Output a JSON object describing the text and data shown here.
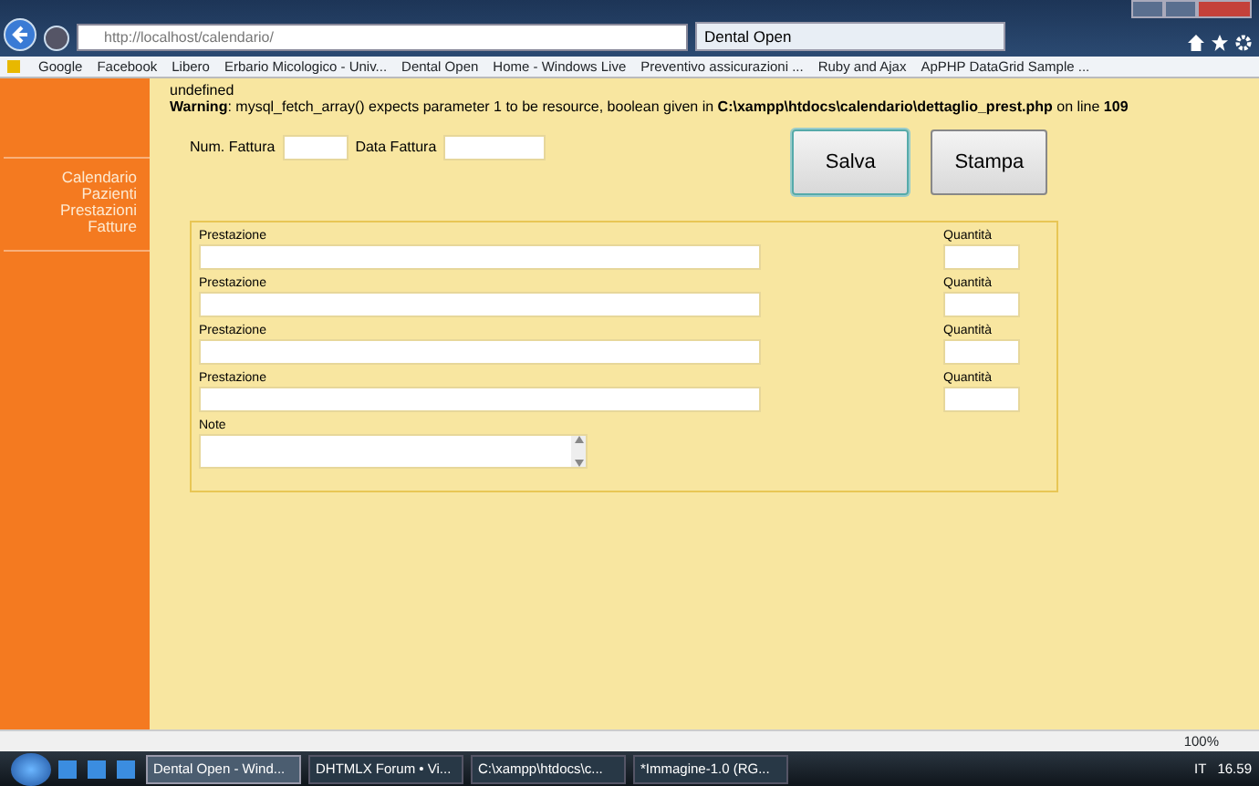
{
  "browser": {
    "address": "http://localhost/calendario/",
    "tabs": [
      {
        "label": "Dental Open",
        "selected": true
      }
    ],
    "favorites": [
      "Google",
      "Facebook",
      "Libero",
      "Erbario Micologico - Univ...",
      "Dental Open",
      "Home - Windows Live",
      "Preventivo assicurazioni ...",
      "Ruby and Ajax",
      "ApPHP DataGrid  Sample ..."
    ]
  },
  "sidebar": {
    "items": [
      "Calendario",
      "Pazienti",
      "Prestazioni",
      "Fatture"
    ]
  },
  "messages": [
    "undefined",
    "**Warning**: mysql_fetch_array() expects parameter 1 to be resource, boolean given in **C:\\xampp\\htdocs\\calendario\\dettaglio_prest.php** on line **109**"
  ],
  "header_fields": [
    {
      "label": "Num. Fattura"
    },
    {
      "label": "Data Fattura"
    }
  ],
  "buttons": [
    {
      "label": "Salva",
      "focused": true
    },
    {
      "label": "Stampa",
      "focused": false
    }
  ],
  "rows": [
    {
      "label": "Prestazione",
      "quantity_label": "Quantità"
    },
    {
      "label": "Prestazione",
      "quantity_label": "Quantità"
    },
    {
      "label": "Prestazione",
      "quantity_label": "Quantità"
    },
    {
      "label": "Prestazione",
      "quantity_label": "Quantità"
    }
  ],
  "notes": {
    "label": "Note"
  },
  "status_bar": {
    "zoom": "100%"
  },
  "taskbar": {
    "items": [
      {
        "label": "Dental Open - Wind...",
        "selected": true
      },
      {
        "label": "DHTMLX Forum • Vi...",
        "selected": false
      },
      {
        "label": "C:\\xampp\\htdocs\\c...",
        "selected": false
      },
      {
        "label": "*Immagine-1.0 (RG...",
        "selected": false
      }
    ],
    "language": "IT",
    "clock": "16.59"
  }
}
